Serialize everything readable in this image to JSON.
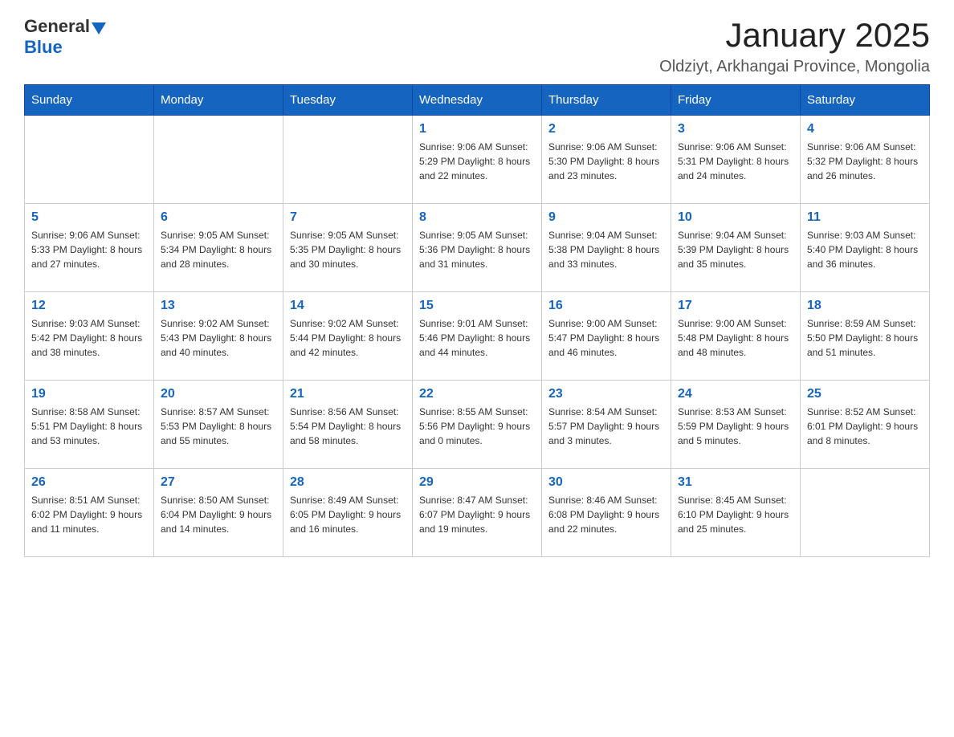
{
  "header": {
    "logo_general": "General",
    "logo_blue": "Blue",
    "month_title": "January 2025",
    "location": "Oldziyt, Arkhangai Province, Mongolia"
  },
  "days_of_week": [
    "Sunday",
    "Monday",
    "Tuesday",
    "Wednesday",
    "Thursday",
    "Friday",
    "Saturday"
  ],
  "weeks": [
    [
      {
        "day": "",
        "info": ""
      },
      {
        "day": "",
        "info": ""
      },
      {
        "day": "",
        "info": ""
      },
      {
        "day": "1",
        "info": "Sunrise: 9:06 AM\nSunset: 5:29 PM\nDaylight: 8 hours\nand 22 minutes."
      },
      {
        "day": "2",
        "info": "Sunrise: 9:06 AM\nSunset: 5:30 PM\nDaylight: 8 hours\nand 23 minutes."
      },
      {
        "day": "3",
        "info": "Sunrise: 9:06 AM\nSunset: 5:31 PM\nDaylight: 8 hours\nand 24 minutes."
      },
      {
        "day": "4",
        "info": "Sunrise: 9:06 AM\nSunset: 5:32 PM\nDaylight: 8 hours\nand 26 minutes."
      }
    ],
    [
      {
        "day": "5",
        "info": "Sunrise: 9:06 AM\nSunset: 5:33 PM\nDaylight: 8 hours\nand 27 minutes."
      },
      {
        "day": "6",
        "info": "Sunrise: 9:05 AM\nSunset: 5:34 PM\nDaylight: 8 hours\nand 28 minutes."
      },
      {
        "day": "7",
        "info": "Sunrise: 9:05 AM\nSunset: 5:35 PM\nDaylight: 8 hours\nand 30 minutes."
      },
      {
        "day": "8",
        "info": "Sunrise: 9:05 AM\nSunset: 5:36 PM\nDaylight: 8 hours\nand 31 minutes."
      },
      {
        "day": "9",
        "info": "Sunrise: 9:04 AM\nSunset: 5:38 PM\nDaylight: 8 hours\nand 33 minutes."
      },
      {
        "day": "10",
        "info": "Sunrise: 9:04 AM\nSunset: 5:39 PM\nDaylight: 8 hours\nand 35 minutes."
      },
      {
        "day": "11",
        "info": "Sunrise: 9:03 AM\nSunset: 5:40 PM\nDaylight: 8 hours\nand 36 minutes."
      }
    ],
    [
      {
        "day": "12",
        "info": "Sunrise: 9:03 AM\nSunset: 5:42 PM\nDaylight: 8 hours\nand 38 minutes."
      },
      {
        "day": "13",
        "info": "Sunrise: 9:02 AM\nSunset: 5:43 PM\nDaylight: 8 hours\nand 40 minutes."
      },
      {
        "day": "14",
        "info": "Sunrise: 9:02 AM\nSunset: 5:44 PM\nDaylight: 8 hours\nand 42 minutes."
      },
      {
        "day": "15",
        "info": "Sunrise: 9:01 AM\nSunset: 5:46 PM\nDaylight: 8 hours\nand 44 minutes."
      },
      {
        "day": "16",
        "info": "Sunrise: 9:00 AM\nSunset: 5:47 PM\nDaylight: 8 hours\nand 46 minutes."
      },
      {
        "day": "17",
        "info": "Sunrise: 9:00 AM\nSunset: 5:48 PM\nDaylight: 8 hours\nand 48 minutes."
      },
      {
        "day": "18",
        "info": "Sunrise: 8:59 AM\nSunset: 5:50 PM\nDaylight: 8 hours\nand 51 minutes."
      }
    ],
    [
      {
        "day": "19",
        "info": "Sunrise: 8:58 AM\nSunset: 5:51 PM\nDaylight: 8 hours\nand 53 minutes."
      },
      {
        "day": "20",
        "info": "Sunrise: 8:57 AM\nSunset: 5:53 PM\nDaylight: 8 hours\nand 55 minutes."
      },
      {
        "day": "21",
        "info": "Sunrise: 8:56 AM\nSunset: 5:54 PM\nDaylight: 8 hours\nand 58 minutes."
      },
      {
        "day": "22",
        "info": "Sunrise: 8:55 AM\nSunset: 5:56 PM\nDaylight: 9 hours\nand 0 minutes."
      },
      {
        "day": "23",
        "info": "Sunrise: 8:54 AM\nSunset: 5:57 PM\nDaylight: 9 hours\nand 3 minutes."
      },
      {
        "day": "24",
        "info": "Sunrise: 8:53 AM\nSunset: 5:59 PM\nDaylight: 9 hours\nand 5 minutes."
      },
      {
        "day": "25",
        "info": "Sunrise: 8:52 AM\nSunset: 6:01 PM\nDaylight: 9 hours\nand 8 minutes."
      }
    ],
    [
      {
        "day": "26",
        "info": "Sunrise: 8:51 AM\nSunset: 6:02 PM\nDaylight: 9 hours\nand 11 minutes."
      },
      {
        "day": "27",
        "info": "Sunrise: 8:50 AM\nSunset: 6:04 PM\nDaylight: 9 hours\nand 14 minutes."
      },
      {
        "day": "28",
        "info": "Sunrise: 8:49 AM\nSunset: 6:05 PM\nDaylight: 9 hours\nand 16 minutes."
      },
      {
        "day": "29",
        "info": "Sunrise: 8:47 AM\nSunset: 6:07 PM\nDaylight: 9 hours\nand 19 minutes."
      },
      {
        "day": "30",
        "info": "Sunrise: 8:46 AM\nSunset: 6:08 PM\nDaylight: 9 hours\nand 22 minutes."
      },
      {
        "day": "31",
        "info": "Sunrise: 8:45 AM\nSunset: 6:10 PM\nDaylight: 9 hours\nand 25 minutes."
      },
      {
        "day": "",
        "info": ""
      }
    ]
  ]
}
